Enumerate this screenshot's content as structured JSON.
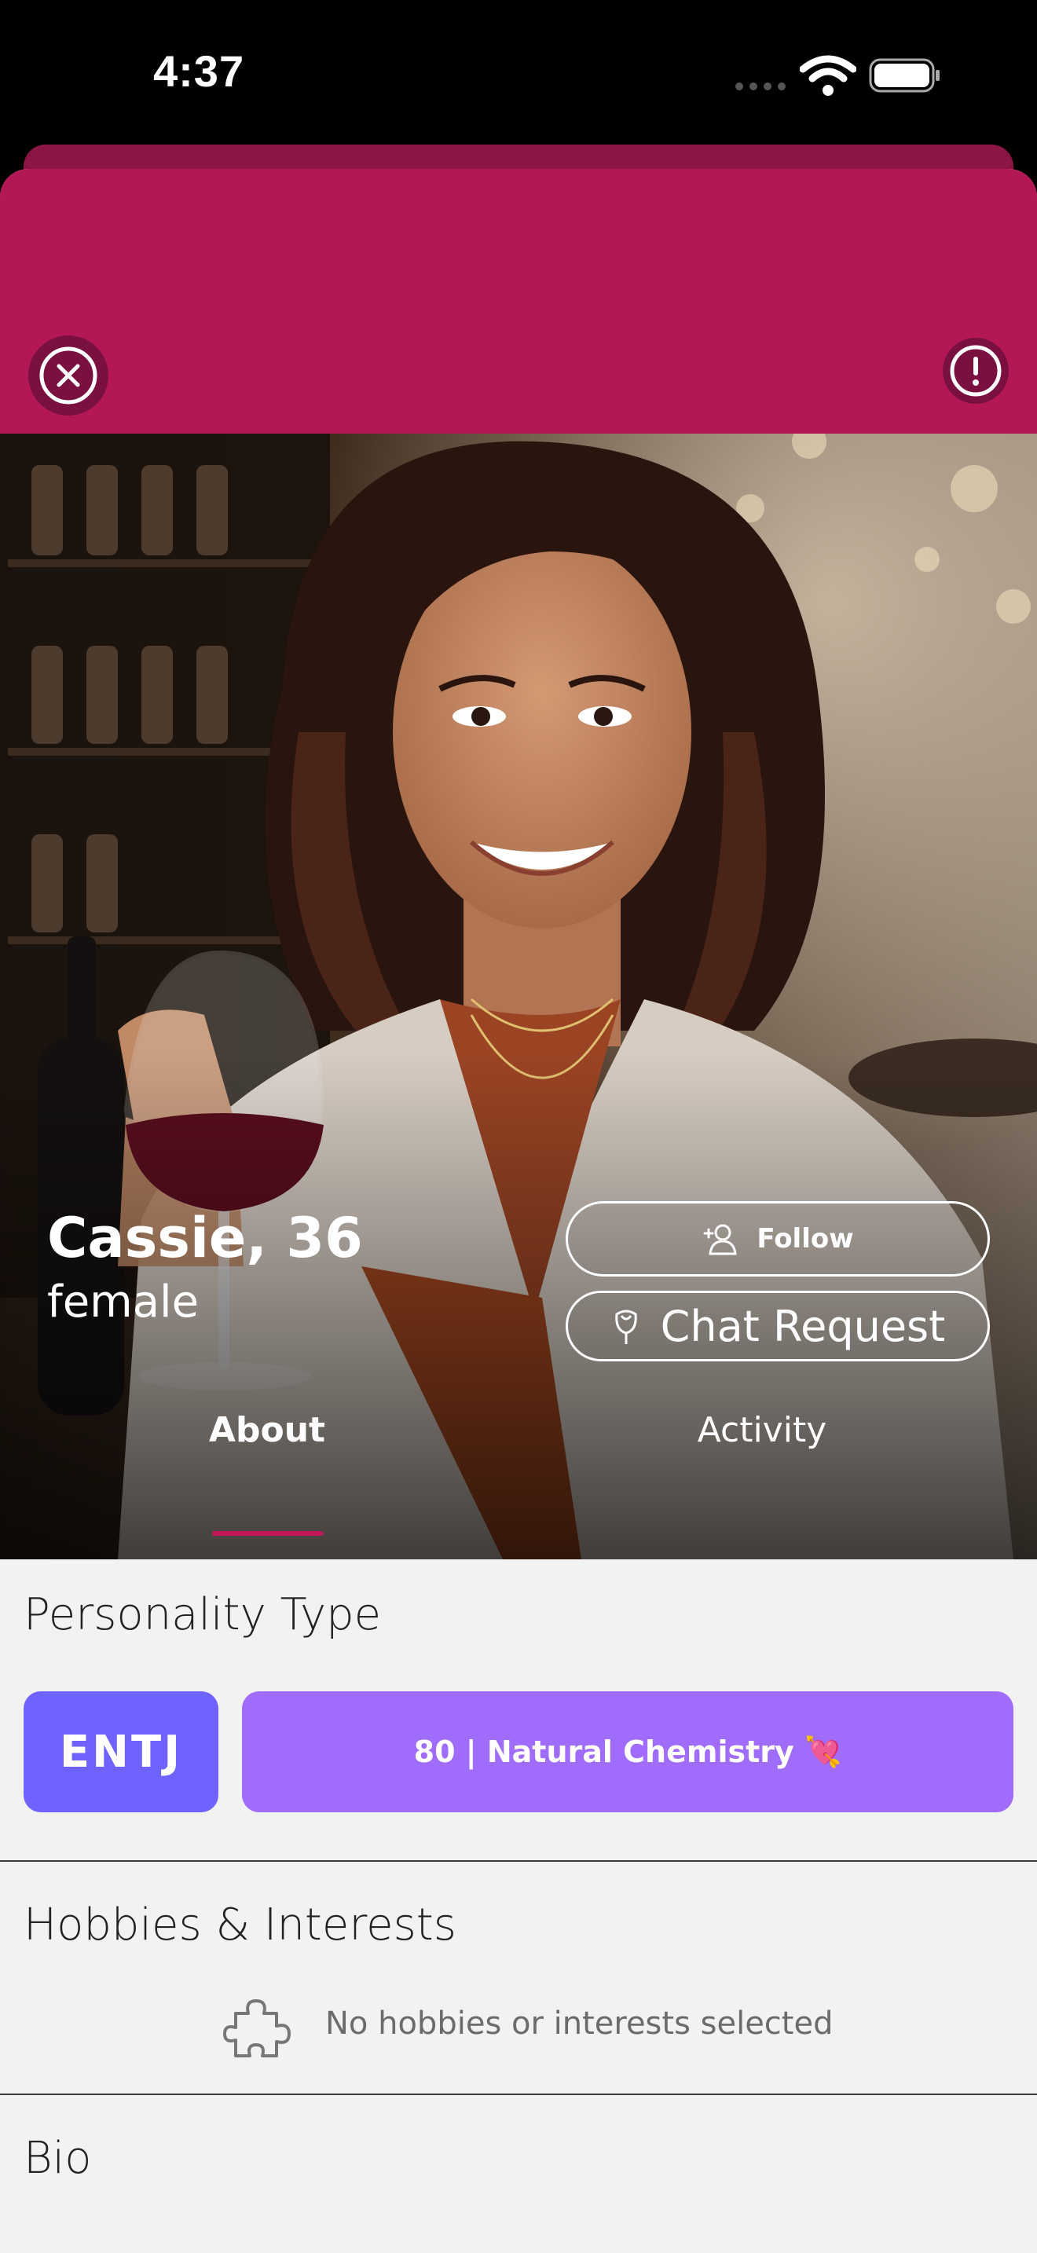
{
  "status_bar": {
    "time": "4:37"
  },
  "profile": {
    "name_age": "Cassie, 36",
    "gender": "female",
    "follow_label": "Follow",
    "chat_request_label": "Chat Request"
  },
  "tabs": [
    {
      "label": "About",
      "selected": true
    },
    {
      "label": "Activity",
      "selected": false
    }
  ],
  "personality": {
    "title": "Personality Type",
    "type": "ENTJ",
    "chemistry": "80 | Natural Chemistry 💘"
  },
  "hobbies": {
    "title": "Hobbies & Interests",
    "empty_text": "No hobbies or interests selected"
  },
  "bio": {
    "title": "Bio"
  },
  "icons": {
    "close": "close-icon",
    "report": "exclamation-icon",
    "follow": "add-person-icon",
    "chat_request": "rose-icon",
    "hobbies_empty": "puzzle-icon"
  },
  "colors": {
    "banner": "#b31756",
    "accent": "#c2185b",
    "mbti": "#6f63ff",
    "chemistry": "#a06cfb"
  }
}
